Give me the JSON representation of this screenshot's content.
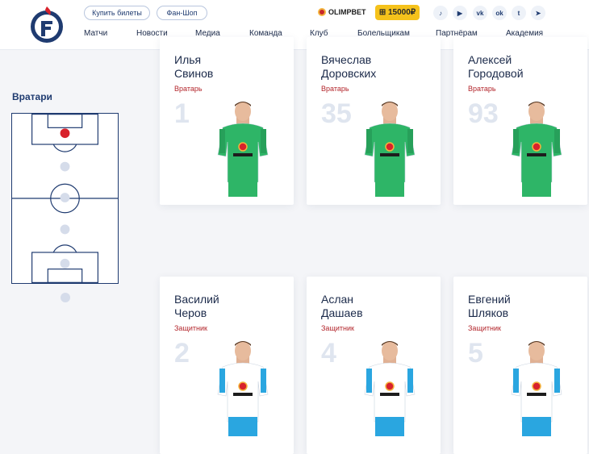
{
  "header": {
    "tickets_label": "Купить билеты",
    "shop_label": "Фан-Шоп",
    "brand": "OLIMPBET",
    "bonus": "⊞ 15000₽",
    "nav": [
      "Матчи",
      "Новости",
      "Медиа",
      "Команда",
      "Клуб",
      "Болельщикам",
      "Партнёрам",
      "Академия"
    ],
    "socials": [
      "tiktok-icon",
      "youtube-icon",
      "vk-icon",
      "ok-icon",
      "twitter-icon",
      "telegram-icon"
    ]
  },
  "sidebar": {
    "title": "Вратари"
  },
  "colors": {
    "navy": "#1f3b70",
    "accent_red": "#d8222c",
    "role_red": "#b3262c",
    "gk_kit": "#2eb567",
    "field_kit": "#ffffff",
    "number_gray": "#dfe5ef"
  },
  "players": [
    {
      "first": "Илья",
      "last": "Свинов",
      "role": "Вратарь",
      "number": "1",
      "kit": "gk"
    },
    {
      "first": "Вячеслав",
      "last": "Доровских",
      "role": "Вратарь",
      "number": "35",
      "kit": "gk"
    },
    {
      "first": "Алексей",
      "last": "Городовой",
      "role": "Вратарь",
      "number": "93",
      "kit": "gk"
    },
    {
      "first": "Василий",
      "last": "Черов",
      "role": "Защитник",
      "number": "2",
      "kit": "field"
    },
    {
      "first": "Аслан",
      "last": "Дашаев",
      "role": "Защитник",
      "number": "4",
      "kit": "field"
    },
    {
      "first": "Евгений",
      "last": "Шляков",
      "role": "Защитник",
      "number": "5",
      "kit": "field"
    }
  ]
}
